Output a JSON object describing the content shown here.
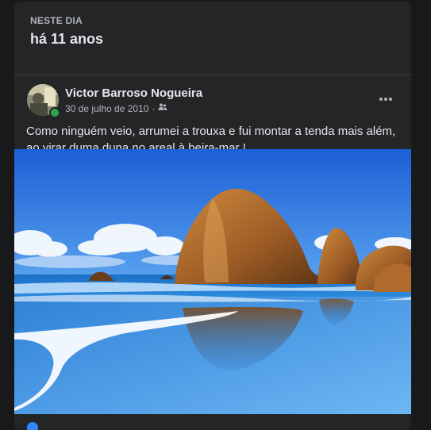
{
  "memory": {
    "kicker": "NESTE DIA",
    "title": "há 11 anos"
  },
  "post": {
    "author": "Victor Barroso Nogueira",
    "date": "30 de julho de 2010",
    "separator": "·",
    "audience_icon": "friends-icon",
    "more_icon": "more-options-icon",
    "text": "Como ninguém veio, arrumei a trouxa  e fui montar a tenda mais além, ao virar duma duna no areal à beira-mar !"
  },
  "colors": {
    "card_bg": "#242526",
    "page_bg": "#18191a",
    "online": "#31a24c"
  }
}
